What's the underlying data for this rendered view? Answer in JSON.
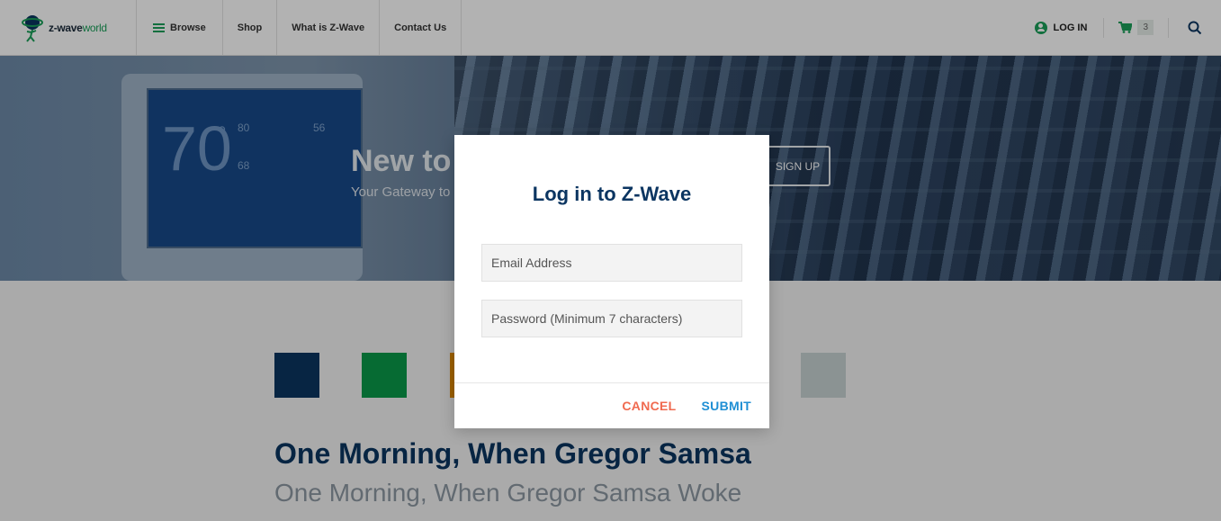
{
  "header": {
    "logo": {
      "z_wave": "z-wave",
      "world": "world"
    },
    "nav": [
      {
        "label": "Browse"
      },
      {
        "label": "Shop"
      },
      {
        "label": "What is Z-Wave"
      },
      {
        "label": "Contact Us"
      }
    ],
    "login_label": "LOG IN",
    "cart_count": "3",
    "icons": {
      "menu": "hamburger-icon",
      "user": "user-icon",
      "cart": "cart-icon",
      "search": "search-icon"
    }
  },
  "hero": {
    "title": "New to",
    "subtitle": "Your Gateway to",
    "signup_label": "SIGN UP",
    "thermostat": {
      "temp": "70",
      "deg": "°",
      "set_high": "80",
      "set_low": "68",
      "outdoor": "56"
    }
  },
  "swatches": {
    "colors": [
      "#0b3561",
      "#0a9a4a",
      "#e08a00",
      "#c7d3d3"
    ]
  },
  "content": {
    "title": "One Morning, When Gregor Samsa",
    "subtitle": "One Morning, When Gregor Samsa Woke"
  },
  "modal": {
    "title": "Log in to Z-Wave",
    "email_placeholder": "Email Address",
    "email_value": "",
    "password_placeholder": "Password (Minimum 7 characters)",
    "password_value": "",
    "cancel_label": "CANCEL",
    "submit_label": "SUBMIT"
  },
  "colors": {
    "brand_navy": "#0b3561",
    "brand_green": "#1aa05a",
    "cancel_red": "#f06a4f",
    "submit_blue": "#1f8fd4"
  }
}
